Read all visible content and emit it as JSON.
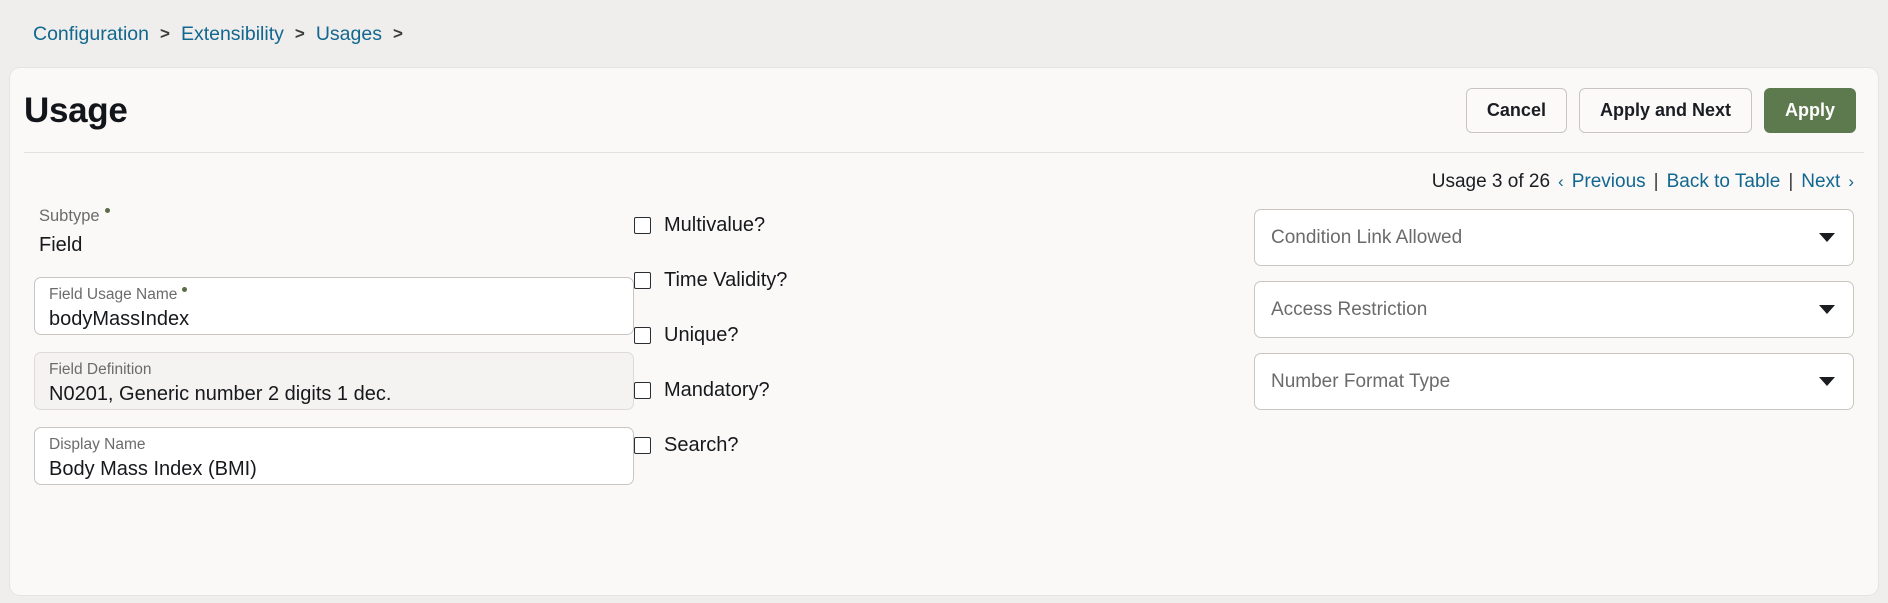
{
  "breadcrumb": {
    "items": [
      {
        "label": "Configuration",
        "separator": ">"
      },
      {
        "label": "Extensibility",
        "separator": ">"
      },
      {
        "label": "Usages",
        "separator": ">"
      }
    ]
  },
  "header": {
    "title": "Usage",
    "buttons": {
      "cancel": "Cancel",
      "apply_and_next": "Apply and Next",
      "apply": "Apply"
    }
  },
  "record_nav": {
    "counter": "Usage 3 of 26",
    "prev_arrow": "‹",
    "previous": "Previous",
    "pipe1": "|",
    "back_to_table": "Back to Table",
    "pipe2": "|",
    "next": "Next",
    "next_arrow": "›"
  },
  "form": {
    "subtype": {
      "label": "Subtype",
      "required": true,
      "value": "Field"
    },
    "fields": [
      {
        "name": "field-usage-name",
        "label": "Field Usage Name",
        "value": "bodyMassIndex",
        "required": true,
        "readonly": false
      },
      {
        "name": "field-definition",
        "label": "Field Definition",
        "value": "N0201, Generic number 2 digits 1 dec.",
        "required": false,
        "readonly": true
      },
      {
        "name": "display-name",
        "label": "Display Name",
        "value": "Body Mass Index (BMI)",
        "required": false,
        "readonly": false
      }
    ],
    "checkboxes": [
      {
        "name": "multivalue",
        "label": "Multivalue?",
        "checked": false
      },
      {
        "name": "time-validity",
        "label": "Time Validity?",
        "checked": false
      },
      {
        "name": "unique",
        "label": "Unique?",
        "checked": false
      },
      {
        "name": "mandatory",
        "label": "Mandatory?",
        "checked": false
      },
      {
        "name": "search",
        "label": "Search?",
        "checked": false
      }
    ],
    "selects": [
      {
        "name": "condition-link-allowed",
        "placeholder": "Condition Link Allowed",
        "value": ""
      },
      {
        "name": "access-restriction",
        "placeholder": "Access Restriction",
        "value": ""
      },
      {
        "name": "number-format-type",
        "placeholder": "Number Format Type",
        "value": ""
      }
    ]
  },
  "colors": {
    "link": "#11678f",
    "primary_button": "#5d7a4e",
    "page_background": "#efeeec",
    "card_background": "#faf9f8",
    "required_marker": "#5a6b46"
  }
}
